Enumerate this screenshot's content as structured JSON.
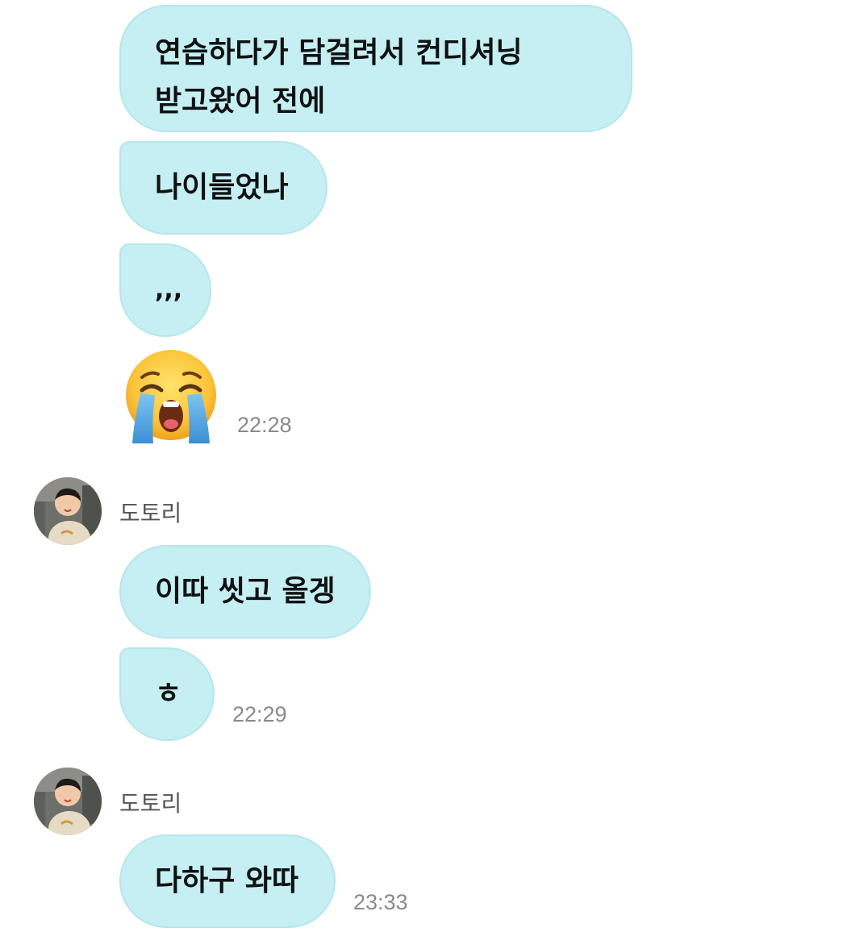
{
  "messages": [
    {
      "text_line1": "연습하다가 담걸려서 컨디셔닝",
      "text_line2": "받고왔어 전에"
    },
    {
      "text": "나이들었나"
    },
    {
      "text": ",,,"
    },
    {
      "emoji": "loudly-crying-face-emoji",
      "time": "22:28"
    },
    {
      "sender": "도토리",
      "text": "이따 씻고 올겡"
    },
    {
      "text": "ㅎ",
      "time": "22:29"
    },
    {
      "sender": "도토리",
      "text": "다하구 와따",
      "time": "23:33"
    }
  ],
  "colors": {
    "bubble_bg": "#c5eff3",
    "bubble_border": "#b5e6ec",
    "time_text": "#8a8a8a",
    "sender_text": "#555555"
  }
}
